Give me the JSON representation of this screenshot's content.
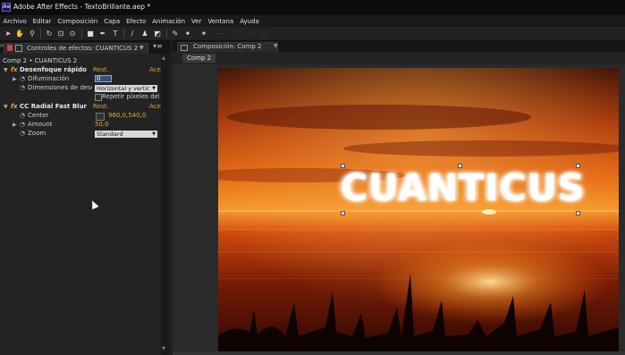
{
  "app": {
    "window_title": "Adobe After Effects - TextoBrillante.aep *",
    "icon_text": "Ae"
  },
  "menu": [
    "Archivo",
    "Editar",
    "Composición",
    "Capa",
    "Efecto",
    "Animación",
    "Ver",
    "Ventana",
    "Ayuda"
  ],
  "toolbar": {
    "tools": [
      "arrow-tool-icon",
      "hand-tool-icon",
      "zoom-tool-icon",
      "rotate-tool-icon",
      "camera-tool-icon",
      "pan-behind-icon",
      "rectangle-tool-icon",
      "pen-tool-icon",
      "type-tool-icon",
      "brush-tool-icon",
      "clone-stamp-icon",
      "eraser-icon",
      "roto-brush-icon",
      "puppet-pin-icon"
    ]
  },
  "effects_panel": {
    "tab_title": "Controles de efectos: CUANTICUS 2",
    "breadcrumb": "Comp 2 • CUANTICUS 2",
    "effects": [
      {
        "name": "Desenfoque rápido",
        "reset": "Rest.",
        "about": "Ace",
        "properties": [
          {
            "label": "Difuminación",
            "value": "0",
            "type": "number-selected"
          },
          {
            "label": "Dimensiones de desenf",
            "value": "Horizontal y vertic",
            "type": "dropdown"
          },
          {
            "label": "Repetir píxeles del b",
            "value": "",
            "type": "checkbox"
          }
        ]
      },
      {
        "name": "CC Radial Fast Blur",
        "reset": "Rest.",
        "about": "Ace",
        "properties": [
          {
            "label": "Center",
            "value": "960,0,540,0",
            "type": "point"
          },
          {
            "label": "Amount",
            "value": "50,0",
            "type": "number"
          },
          {
            "label": "Zoom",
            "value": "Standard",
            "type": "dropdown"
          }
        ]
      }
    ]
  },
  "composition_panel": {
    "tab_title": "Composición: Comp 2",
    "subtab": "Comp 2",
    "headline_text": "CUANTICUS"
  },
  "colors": {
    "accent_orange": "#e0a13a",
    "panel_bg": "#232323",
    "menubar_bg": "#1a1a1a"
  }
}
